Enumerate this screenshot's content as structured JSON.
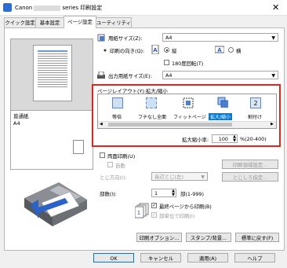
{
  "window": {
    "title_prefix": "Canon",
    "title_suffix": "series 印刷設定",
    "close": "✕"
  },
  "tabs": [
    "クイック設定",
    "基本設定",
    "ページ設定",
    "ユーティリティ"
  ],
  "active_tab": 2,
  "preview": {
    "media_line1": "普通紙",
    "media_line2": "A4"
  },
  "paper_size": {
    "label": "用紙サイズ(Z):",
    "value": "A4"
  },
  "orientation": {
    "label": "印刷の向き(Q):",
    "portrait": "縦",
    "landscape": "横",
    "rotate": "180度回転(T)"
  },
  "output_size": {
    "label": "出力用紙サイズ(E):",
    "value": "A4"
  },
  "page_layout": {
    "label": "ページレイアウト(Y):拡大/縮小",
    "items": [
      "等倍",
      "フチなし全面",
      "フィットページ",
      "拡大/縮小",
      "割付け"
    ],
    "selected": 3,
    "scale_label": "拡大縮小率:",
    "scale_value": "100",
    "scale_unit": "%(20-400)"
  },
  "duplex": {
    "label": "両面印刷(U)",
    "auto": "自動",
    "settings_btn": "印刷領域設定...",
    "binding_label": "とじ方向(I):",
    "binding_value": "長辺とじ(左)",
    "margin_btn": "とじしろ指定..."
  },
  "copies": {
    "label": "部数(I):",
    "value": "1",
    "range": "部(1-999)",
    "last_page": "最終ページから印刷(B)",
    "collate": "部単位で印刷(I)"
  },
  "bottom_buttons": {
    "options": "印刷オプション...",
    "stamp": "スタンプ/背景...",
    "defaults": "標準に戻す(F)"
  },
  "dialog_buttons": {
    "ok": "OK",
    "cancel": "キャンセル",
    "apply": "適用(A)",
    "help": "ヘルプ"
  }
}
